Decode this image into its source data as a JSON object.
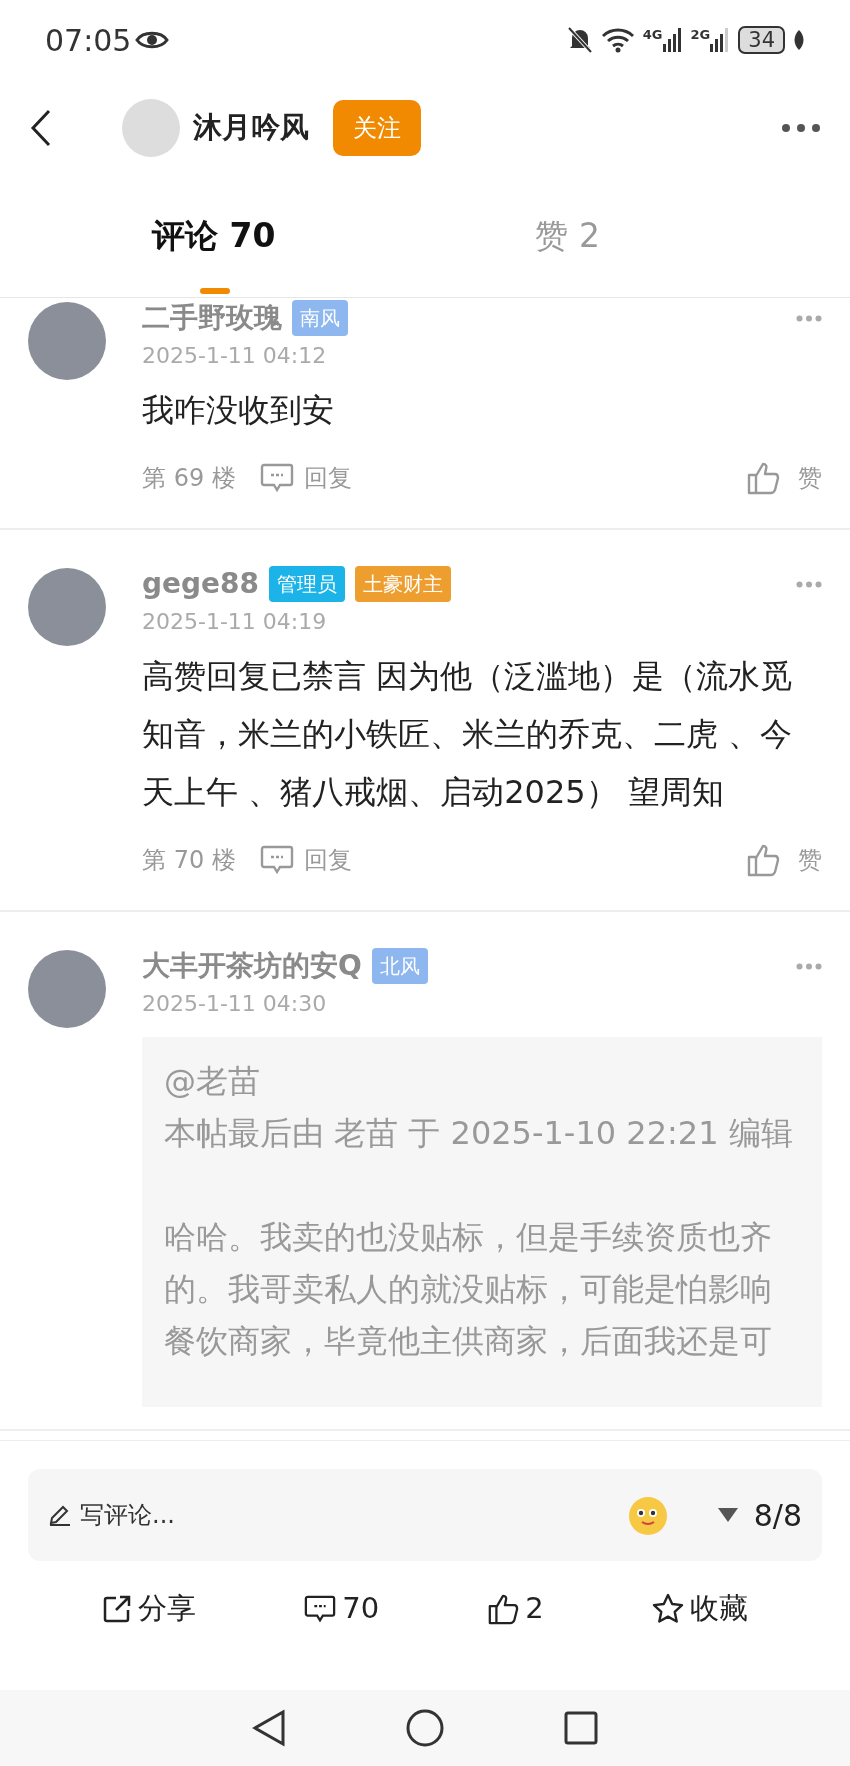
{
  "status_bar": {
    "time": "07:05",
    "network_1": "4G",
    "network_2": "2G",
    "battery": "34"
  },
  "header": {
    "author": "沐月吟风",
    "follow_label": "关注"
  },
  "tabs": [
    {
      "label": "评论 70",
      "selected": true
    },
    {
      "label": "赞 2",
      "selected": false
    }
  ],
  "comments": [
    {
      "user": "二手野玫瑰",
      "badges": [
        {
          "text": "南风",
          "color": "#8db7ee"
        }
      ],
      "date": "2025-1-11 04:12",
      "text": "我咋没收到安",
      "floor": "第 69 楼",
      "reply_label": "回复",
      "like_label": "赞"
    },
    {
      "user": "gege88",
      "badges": [
        {
          "text": "管理员",
          "color": "#1bb3e8"
        },
        {
          "text": "土豪财主",
          "color": "#ee9e2e"
        }
      ],
      "date": "2025-1-11 04:19",
      "text": "高赞回复已禁言 因为他（泛滥地）是（流水觅知音，米兰的小铁匠、米兰的乔克、二虎 、今天上午 、猪八戒烟、启动2025） 望周知",
      "floor": "第 70 楼",
      "reply_label": "回复",
      "like_label": "赞"
    },
    {
      "user": "大丰开茶坊的安Q",
      "badges": [
        {
          "text": "北风",
          "color": "#8db7ee"
        }
      ],
      "date": "2025-1-11 04:30",
      "quote": {
        "mention": "@老苗",
        "edit_note": "本帖最后由 老苗 于 2025-1-10 22:21 编辑",
        "text": "哈哈。我卖的也没贴标，但是手续资质也齐的。我哥卖私人的就没贴标，可能是怕影响餐饮商家，毕竟他主供商家，后面我还是可"
      }
    }
  ],
  "comment_box": {
    "placeholder": "写评论...",
    "page": "8/8"
  },
  "actions": [
    {
      "kind": "share",
      "label": "分享"
    },
    {
      "kind": "comment",
      "label": "70"
    },
    {
      "kind": "like",
      "label": "2"
    },
    {
      "kind": "favorite",
      "label": "收藏"
    }
  ]
}
